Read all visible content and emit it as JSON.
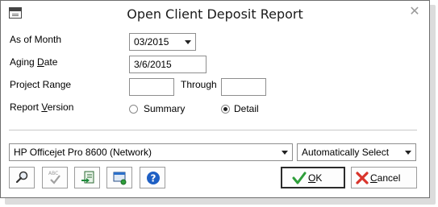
{
  "window": {
    "title": "Open Client Deposit Report"
  },
  "fields": {
    "as_of_month": {
      "label_pre": "As of Month",
      "value": "03/2015"
    },
    "aging_date": {
      "label_pre": "Aging ",
      "label_u": "D",
      "label_post": "ate",
      "value": "3/6/2015"
    },
    "project_range": {
      "label": "Project Range",
      "from": "",
      "through_label": "Through",
      "to": ""
    },
    "report_version": {
      "label_pre": "Report ",
      "label_u": "V",
      "label_post": "ersion",
      "options": [
        {
          "label": "Summary",
          "selected": false
        },
        {
          "label": "Detail",
          "selected": true
        }
      ]
    }
  },
  "printer": {
    "value": "HP Officejet Pro 8600 (Network)"
  },
  "tray": {
    "value": "Automatically Select"
  },
  "toolbar_icons": [
    "magnifier-icon",
    "spellcheck-icon",
    "export-icon",
    "print-setup-icon",
    "help-icon"
  ],
  "buttons": {
    "ok_u": "O",
    "ok_post": "K",
    "cancel_u": "C",
    "cancel_post": "ancel"
  },
  "colors": {
    "ok_check": "#2e9e3a",
    "cancel_x": "#d9342b",
    "help_blue": "#1e5fc4"
  }
}
